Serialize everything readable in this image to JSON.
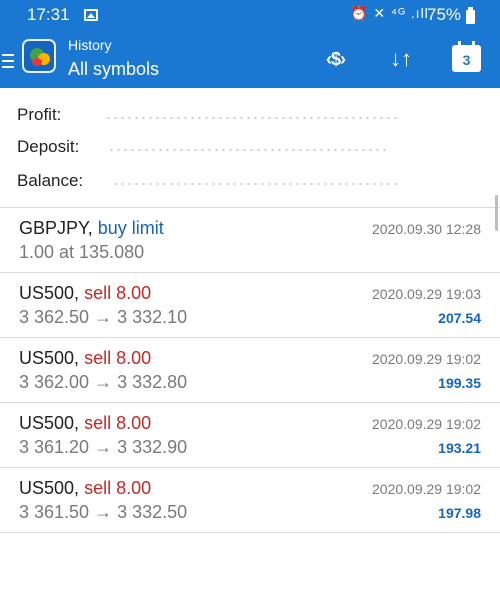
{
  "status_bar": {
    "time": "17:31",
    "status_icons": "⏰ ✕ ⁴ᴳ .ıll",
    "battery": "75%"
  },
  "app_bar": {
    "title": "History",
    "subtitle": "All symbols",
    "calendar_day": "3",
    "transfer_icon_text": "‹$›",
    "sort_icon_text": "↓↑"
  },
  "summary": {
    "profit_label": "Profit:",
    "deposit_label": "Deposit:",
    "balance_label": "Balance:"
  },
  "orders": [
    {
      "symbol": "GBPJPY",
      "sep": ",",
      "action": "buy limit",
      "detail": "1.00 at 135.080",
      "time": "2020.09.30 12:28",
      "profit": ""
    },
    {
      "symbol": "US500",
      "sep": ",",
      "action": "sell 8.00",
      "detail": "3 362.50 → 3 332.10",
      "time": "2020.09.29 19:03",
      "profit": "207.54"
    },
    {
      "symbol": "US500",
      "sep": ",",
      "action": "sell 8.00",
      "detail": "3 362.00 → 3 332.80",
      "time": "2020.09.29 19:02",
      "profit": "199.35"
    },
    {
      "symbol": "US500",
      "sep": ",",
      "action": "sell 8.00",
      "detail": "3 361.20 → 3 332.90",
      "time": "2020.09.29 19:02",
      "profit": "193.21"
    },
    {
      "symbol": "US500",
      "sep": ",",
      "action": "sell 8.00",
      "detail": "3 361.50 → 3 332.50",
      "time": "2020.09.29 19:02",
      "profit": "197.98"
    }
  ],
  "colors": {
    "app_bar": "#1b78d2",
    "buy": "#1565c0",
    "sell": "#c62828",
    "profit": "#1565c0",
    "secondary_text": "#7a7a7a"
  }
}
